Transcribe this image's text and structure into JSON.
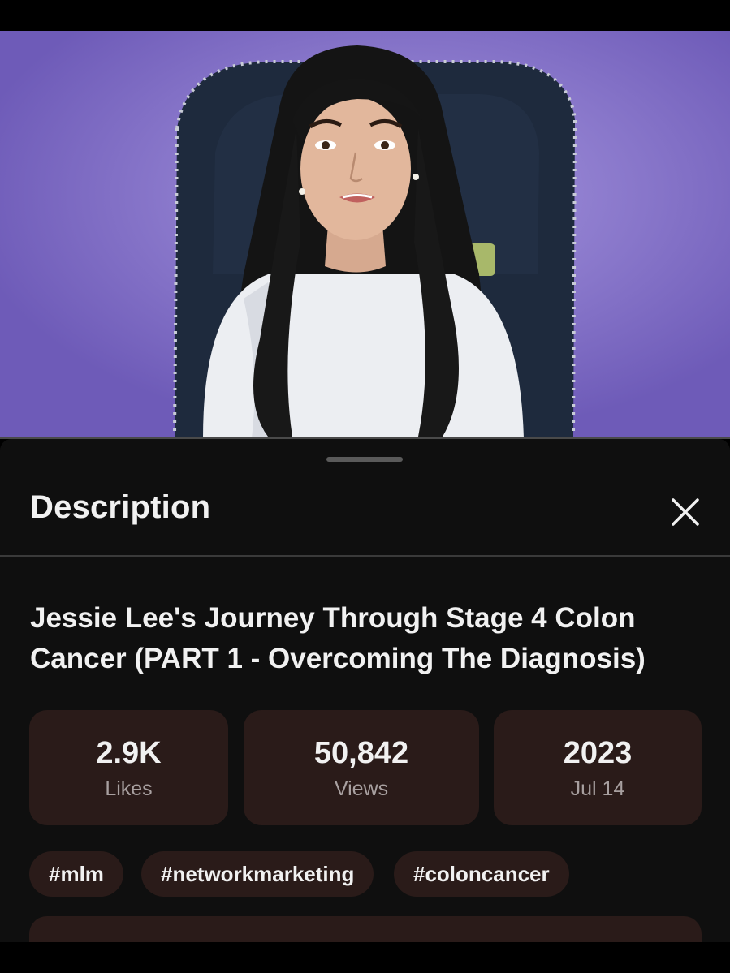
{
  "sheet": {
    "title": "Description",
    "close_icon": "close-icon"
  },
  "video": {
    "title": "Jessie Lee's Journey Through Stage 4 Colon Cancer (PART 1 - Overcoming The Diagnosis)"
  },
  "stats": [
    {
      "value": "2.9K",
      "label": "Likes"
    },
    {
      "value": "50,842",
      "label": "Views"
    },
    {
      "value": "2023",
      "label": "Jul 14"
    }
  ],
  "tags": [
    "#mlm",
    "#networkmarketing",
    "#coloncancer"
  ],
  "colors": {
    "sheet_bg": "#0f0f0f",
    "card_bg": "#2a1b19",
    "text_primary": "#f1f1f1",
    "text_secondary": "#a8a0a0",
    "video_bg": "#8a76d2"
  }
}
